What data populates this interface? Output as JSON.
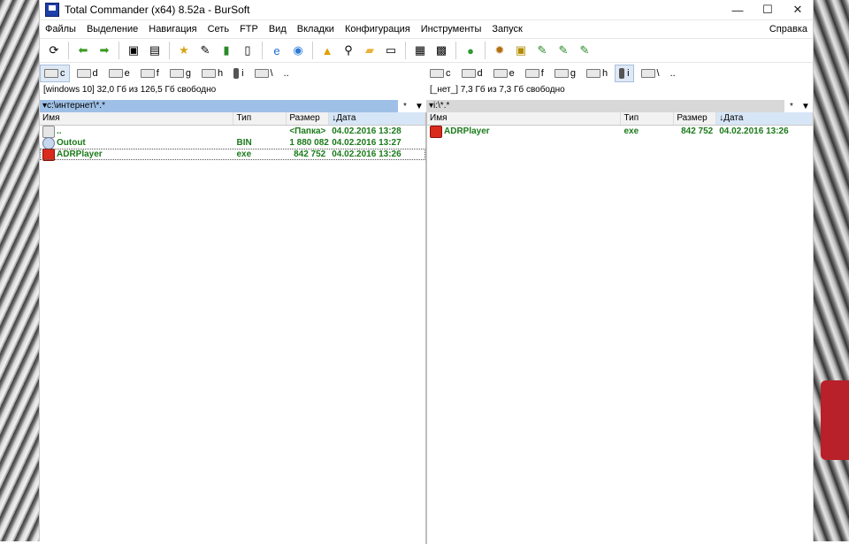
{
  "window": {
    "title": "Total Commander (x64) 8.52a - BurSoft",
    "controls": [
      "—",
      "☐",
      "✕"
    ]
  },
  "menu": {
    "items": [
      "Файлы",
      "Выделение",
      "Навигация",
      "Сеть",
      "FTP",
      "Вид",
      "Вкладки",
      "Конфигурация",
      "Инструменты",
      "Запуск"
    ],
    "help": "Справка"
  },
  "toolbar": {
    "icons": [
      "refresh-icon",
      "back-arrow-icon",
      "forward-arrow-icon",
      "pack-icon",
      "unpack-icon",
      "favorites-icon",
      "edit-icon",
      "stats-icon",
      "clipboard-icon",
      "ie-icon",
      "globe-icon",
      "warning-icon",
      "search-icon",
      "notes-icon",
      "document-icon",
      "image-icon",
      "compare-icon",
      "green-circle-icon",
      "gear-icon",
      "pdf-icon",
      "edit-note-icon",
      "edit-note-2-icon",
      "edit-note-3-icon"
    ]
  },
  "left": {
    "drives": [
      "c",
      "d",
      "e",
      "f",
      "g",
      "h",
      "i",
      "\\",
      ".."
    ],
    "active_drive": "c",
    "free": "[windows 10]  32,0 Гб из 126,5 Гб свободно",
    "path": "c:\\интернет\\*.*",
    "path_star": "*",
    "columns": {
      "name": "Имя",
      "type": "Тип",
      "size": "Размер",
      "date": "Дата"
    },
    "rows": [
      {
        "icon": "up",
        "name": "..",
        "type": "",
        "size": "<Папка>",
        "date": "04.02.2016 13:28"
      },
      {
        "icon": "disc",
        "name": "Outout",
        "type": "BIN",
        "size": "1 880 082",
        "date": "04.02.2016 13:27"
      },
      {
        "icon": "app",
        "name": "ADRPlayer",
        "type": "exe",
        "size": "842 752",
        "date": "04.02.2016 13:26"
      }
    ]
  },
  "right": {
    "drives": [
      "c",
      "d",
      "e",
      "f",
      "g",
      "h",
      "i",
      "\\",
      ".."
    ],
    "active_drive": "i",
    "free": "[_нет_]  7,3 Гб из 7,3 Гб свободно",
    "path": "i:\\*.*",
    "path_star": "*",
    "columns": {
      "name": "Имя",
      "type": "Тип",
      "size": "Размер",
      "date": "Дата"
    },
    "rows": [
      {
        "icon": "app",
        "name": "ADRPlayer",
        "type": "exe",
        "size": "842 752",
        "date": "04.02.2016 13:26"
      }
    ]
  },
  "colors": {
    "active_path": "#9fc0e6",
    "file_text": "#1a7a1a",
    "sorted_column": "#d7e6f7"
  }
}
